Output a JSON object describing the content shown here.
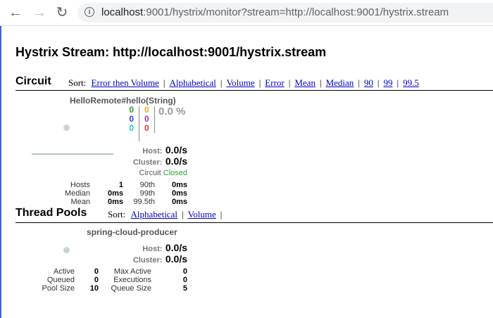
{
  "browser": {
    "url_host": "localhost",
    "url_rest": ":9001/hystrix/monitor?stream=http://localhost:9001/hystrix.stream"
  },
  "page": {
    "title": "Hystrix Stream: http://localhost:9001/hystrix.stream"
  },
  "circuit": {
    "section_title": "Circuit",
    "sort_label": "Sort:",
    "sort_links": [
      "Error then Volume",
      "Alphabetical",
      "Volume",
      "Error",
      "Mean",
      "Median",
      "90",
      "99",
      "99.5"
    ],
    "card": {
      "name": "HelloRemote#hello(String)",
      "counts_a": [
        "0",
        "0",
        "0"
      ],
      "counts_b": [
        "0",
        "0",
        "0"
      ],
      "error_pct": "0.0 %",
      "host_label": "Host:",
      "host_value": "0.0/s",
      "cluster_label": "Cluster:",
      "cluster_value": "0.0/s",
      "circuit_label": "Circuit",
      "circuit_status": "Closed",
      "stats": [
        {
          "label": "Hosts",
          "value": "1",
          "label2": "90th",
          "value2": "0ms"
        },
        {
          "label": "Median",
          "value": "0ms",
          "label2": "99th",
          "value2": "0ms"
        },
        {
          "label": "Mean",
          "value": "0ms",
          "label2": "99.5th",
          "value2": "0ms"
        }
      ]
    }
  },
  "thread_pools": {
    "section_title": "Thread Pools",
    "sort_label": "Sort:",
    "sort_links": [
      "Alphabetical",
      "Volume"
    ],
    "card": {
      "name": "spring-cloud-producer",
      "host_label": "Host:",
      "host_value": "0.0/s",
      "cluster_label": "Cluster:",
      "cluster_value": "0.0/s",
      "stats": [
        {
          "label": "Active",
          "value": "0",
          "label2": "Max Active",
          "value2": "0"
        },
        {
          "label": "Queued",
          "value": "0",
          "label2": "Executions",
          "value2": "0"
        },
        {
          "label": "Pool Size",
          "value": "10",
          "label2": "Queue Size",
          "value2": "5"
        }
      ]
    }
  },
  "colors": {
    "green": "#2ca02c",
    "blue": "#1f3fff",
    "teal": "#19c7c7",
    "orange": "#f5a623",
    "purple": "#9a3bb5",
    "red": "#e0303a"
  }
}
